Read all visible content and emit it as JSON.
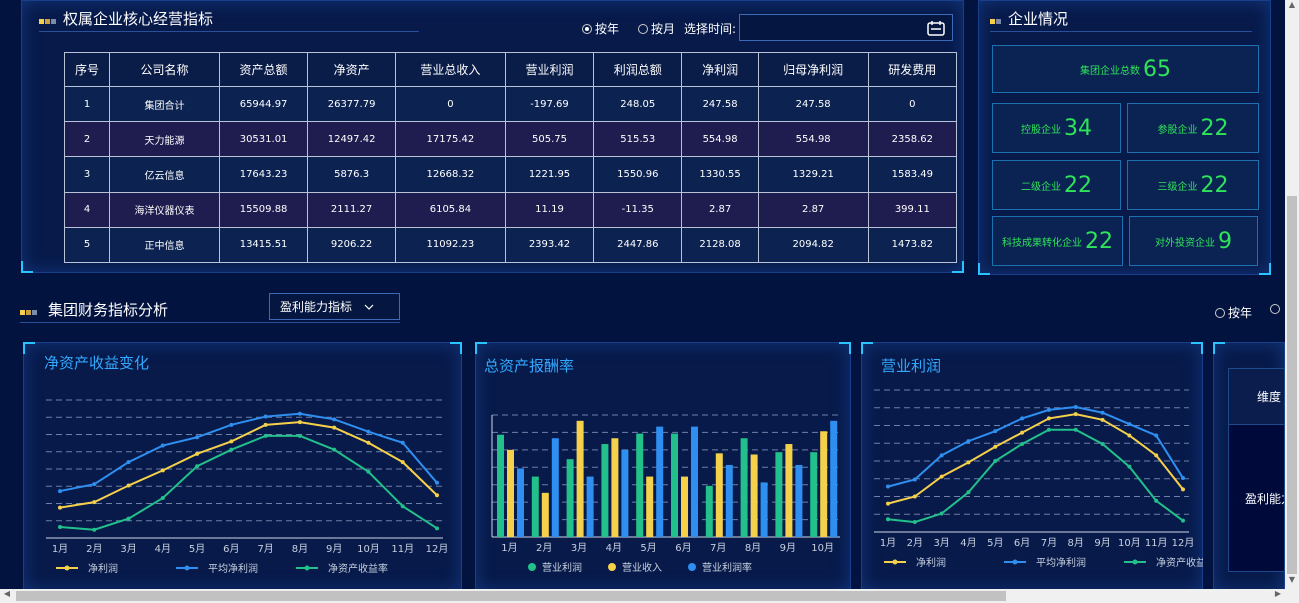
{
  "kpi": {
    "title": "权属企业核心经营指标",
    "radio_year": "按年",
    "radio_month": "按月",
    "time_label": "选择时间:",
    "columns": [
      "序号",
      "公司名称",
      "资产总额",
      "净资产",
      "营业总收入",
      "营业利润",
      "利润总额",
      "净利润",
      "归母净利润",
      "研发费用"
    ],
    "rows": [
      [
        "1",
        "集团合计",
        "65944.97",
        "26377.79",
        "0",
        "-197.69",
        "248.05",
        "247.58",
        "247.58",
        "0"
      ],
      [
        "2",
        "天力能源",
        "30531.01",
        "12497.42",
        "17175.42",
        "505.75",
        "515.53",
        "554.98",
        "554.98",
        "2358.62"
      ],
      [
        "3",
        "亿云信息",
        "17643.23",
        "5876.3",
        "12668.32",
        "1221.95",
        "1550.96",
        "1330.55",
        "1329.21",
        "1583.49"
      ],
      [
        "4",
        "海洋仪器仪表",
        "15509.88",
        "2111.27",
        "6105.84",
        "11.19",
        "-11.35",
        "2.87",
        "2.87",
        "399.11"
      ],
      [
        "5",
        "正中信息",
        "13415.51",
        "9206.22",
        "11092.23",
        "2393.42",
        "2447.86",
        "2128.08",
        "2094.82",
        "1473.82"
      ]
    ]
  },
  "enterprise": {
    "title": "企业情况",
    "total_label": "集团企业总数",
    "total": "65",
    "holding_label": "控股企业",
    "holding": "34",
    "share_label": "参股企业",
    "share": "22",
    "second_label": "二级企业",
    "second": "22",
    "third_label": "三级企业",
    "third": "22",
    "tech_label": "科技成果转化企业",
    "tech": "22",
    "invest_label": "对外投资企业",
    "invest": "9"
  },
  "finance": {
    "title": "集团财务指标分析",
    "dropdown": "盈利能力指标",
    "radio_year": "按年"
  },
  "side_table": {
    "header": "维度",
    "cell": "盈利能力"
  },
  "colors": {
    "yellow": "#f5d04a",
    "blue": "#2f8ff0",
    "green": "#22c08a",
    "accent": "#29c4ff"
  },
  "chart_data": [
    {
      "type": "line",
      "title": "净资产收益变化",
      "categories": [
        "1月",
        "2月",
        "3月",
        "4月",
        "5月",
        "6月",
        "7月",
        "8月",
        "9月",
        "10月",
        "11月",
        "12月"
      ],
      "series": [
        {
          "name": "净利润",
          "values": [
            1.2,
            1.6,
            2.8,
            3.9,
            5.1,
            6.0,
            7.2,
            7.4,
            7.0,
            5.9,
            4.5,
            2.1
          ]
        },
        {
          "name": "平均净利润",
          "values": [
            2.4,
            2.9,
            4.5,
            5.7,
            6.3,
            7.2,
            7.8,
            8.0,
            7.6,
            6.7,
            5.9,
            3.0
          ]
        },
        {
          "name": "净资产收益率",
          "values": [
            -0.2,
            -0.4,
            0.4,
            1.9,
            4.2,
            5.4,
            6.4,
            6.4,
            5.4,
            3.8,
            1.3,
            -0.3
          ]
        }
      ]
    },
    {
      "type": "bar",
      "title": "总资产报酬率",
      "categories": [
        "1月",
        "2月",
        "3月",
        "4月",
        "5月",
        "6月",
        "7月",
        "8月",
        "9月",
        "10月"
      ],
      "series": [
        {
          "name": "营业利润",
          "values": [
            8.8,
            5.2,
            6.7,
            8.0,
            8.9,
            8.9,
            4.4,
            8.5,
            7.3,
            7.3
          ]
        },
        {
          "name": "营业收入",
          "values": [
            7.5,
            3.8,
            10.0,
            8.5,
            5.2,
            5.2,
            7.2,
            7.1,
            8.0,
            9.1
          ]
        },
        {
          "name": "营业利润率",
          "values": [
            5.9,
            8.5,
            5.2,
            7.5,
            9.5,
            9.5,
            6.2,
            4.7,
            6.2,
            10.0
          ]
        }
      ]
    },
    {
      "type": "line",
      "title": "营业利润",
      "categories": [
        "1月",
        "2月",
        "3月",
        "4月",
        "5月",
        "6月",
        "7月",
        "8月",
        "9月",
        "10月",
        "11月",
        "12月"
      ],
      "series": [
        {
          "name": "净利润",
          "values": [
            1.0,
            1.5,
            2.9,
            3.9,
            5.0,
            6.0,
            7.0,
            7.3,
            6.9,
            5.8,
            4.4,
            2.0
          ]
        },
        {
          "name": "平均净利润",
          "values": [
            2.2,
            2.7,
            4.4,
            5.4,
            6.1,
            7.0,
            7.6,
            7.8,
            7.4,
            6.6,
            5.8,
            2.8
          ]
        },
        {
          "name": "净资产收益率",
          "values": [
            -0.1,
            -0.3,
            0.3,
            1.8,
            4.0,
            5.2,
            6.2,
            6.2,
            5.2,
            3.6,
            1.2,
            -0.2
          ]
        }
      ]
    }
  ]
}
